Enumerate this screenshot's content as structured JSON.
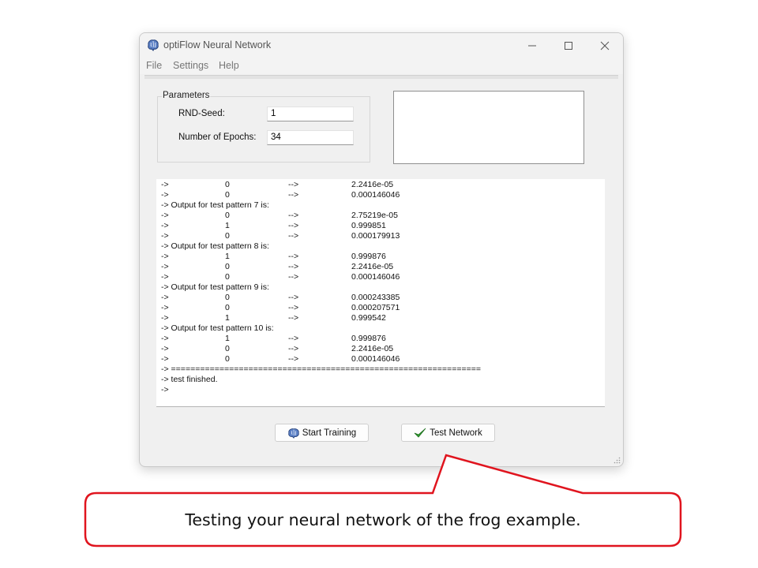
{
  "window": {
    "title": "optiFlow Neural Network",
    "icon": "brain-icon"
  },
  "menu": {
    "items": [
      "File",
      "Settings",
      "Help"
    ]
  },
  "parameters": {
    "group_title": "Parameters",
    "rnd_seed_label": "RND-Seed:",
    "rnd_seed_value": "1",
    "epochs_label": "Number of Epochs:",
    "epochs_value": "34"
  },
  "output_lines": [
    [
      "->",
      "0",
      "-->",
      "2.2416e-05"
    ],
    [
      "->",
      "0",
      "-->",
      "0.000146046"
    ],
    [
      "-> Output for test pattern 7 is:"
    ],
    [
      "->",
      "0",
      "-->",
      "2.75219e-05"
    ],
    [
      "->",
      "1",
      "-->",
      "0.999851"
    ],
    [
      "->",
      "0",
      "-->",
      "0.000179913"
    ],
    [
      "-> Output for test pattern 8 is:"
    ],
    [
      "->",
      "1",
      "-->",
      "0.999876"
    ],
    [
      "->",
      "0",
      "-->",
      "2.2416e-05"
    ],
    [
      "->",
      "0",
      "-->",
      "0.000146046"
    ],
    [
      "-> Output for test pattern 9 is:"
    ],
    [
      "->",
      "0",
      "-->",
      "0.000243385"
    ],
    [
      "->",
      "0",
      "-->",
      "0.000207571"
    ],
    [
      "->",
      "1",
      "-->",
      "0.999542"
    ],
    [
      "-> Output for test pattern 10 is:"
    ],
    [
      "->",
      "1",
      "-->",
      "0.999876"
    ],
    [
      "->",
      "0",
      "-->",
      "2.2416e-05"
    ],
    [
      "->",
      "0",
      "-->",
      "0.000146046"
    ],
    [
      "-> ================================================================"
    ],
    [
      "-> test finished."
    ],
    [
      "->"
    ]
  ],
  "buttons": {
    "start_training": {
      "label": "Start Training",
      "icon": "brain-icon"
    },
    "test_network": {
      "label": "Test Network",
      "icon": "checkmark-icon"
    }
  },
  "callout": {
    "text": "Testing your neural network of the frog example.",
    "border_color": "#e0141e"
  },
  "colors": {
    "check_green": "#2e9e2e",
    "brain_blue": "#3a5fa8"
  }
}
